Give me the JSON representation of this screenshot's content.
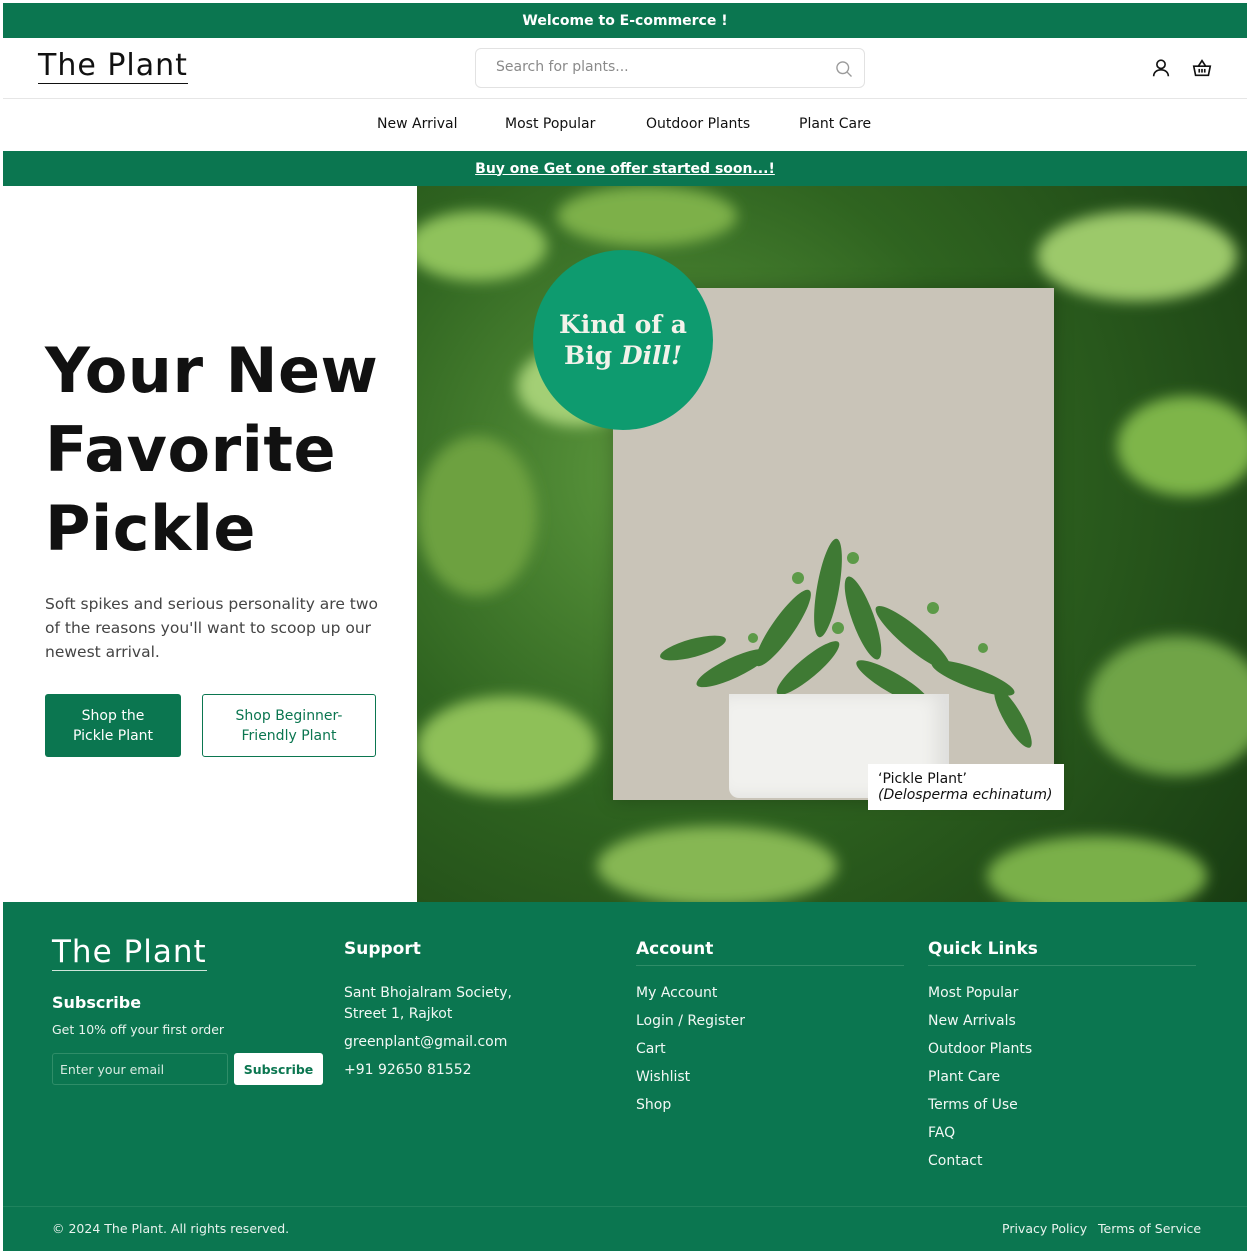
{
  "topbar": {
    "text": "Welcome to E-commerce !"
  },
  "header": {
    "logo": "The Plant",
    "search_placeholder": "Search for plants..."
  },
  "nav": {
    "items": [
      "New Arrival",
      "Most Popular",
      "Outdoor Plants",
      "Plant Care"
    ]
  },
  "promo": {
    "text": "Buy one Get one offer started soon...!"
  },
  "hero": {
    "title_lines": [
      "Your New",
      "Favorite",
      "Pickle"
    ],
    "description": "Soft spikes and serious personality are two of the reasons you'll want to scoop up our newest arrival.",
    "btn_primary_line1": "Shop the",
    "btn_primary_line2": "Pickle Plant",
    "btn_outline_line1": "Shop Beginner-",
    "btn_outline_line2": "Friendly Plant",
    "badge_line1": "Kind of a",
    "badge_line2_a": "Big",
    "badge_line2_b": "Dill!",
    "caption_name": "‘Pickle Plant’",
    "caption_sci": "(Delosperma echinatum)"
  },
  "footer": {
    "logo": "The Plant",
    "subscribe_title": "Subscribe",
    "subscribe_desc": "Get 10% off your first order",
    "email_placeholder": "Enter your email",
    "subscribe_button": "Subscribe",
    "support": {
      "title": "Support",
      "address_line1": "Sant Bhojalram Society,",
      "address_line2": "Street 1, Rajkot",
      "email": "greenplant@gmail.com",
      "phone": "+91 92650 81552"
    },
    "account": {
      "title": "Account",
      "links": [
        "My Account",
        "Login / Register",
        "Cart",
        "Wishlist",
        "Shop"
      ]
    },
    "quick": {
      "title": "Quick Links",
      "links": [
        "Most Popular",
        "New Arrivals",
        "Outdoor Plants",
        "Plant Care",
        "Terms of Use",
        "FAQ",
        "Contact"
      ]
    },
    "copyright": "© 2024 The Plant. All rights reserved.",
    "privacy": "Privacy Policy",
    "terms": "Terms of Service"
  },
  "colors": {
    "brand_green": "#0b7650",
    "badge_green": "#0e9b6f"
  },
  "icons": [
    "search-icon",
    "user-icon",
    "basket-icon"
  ]
}
